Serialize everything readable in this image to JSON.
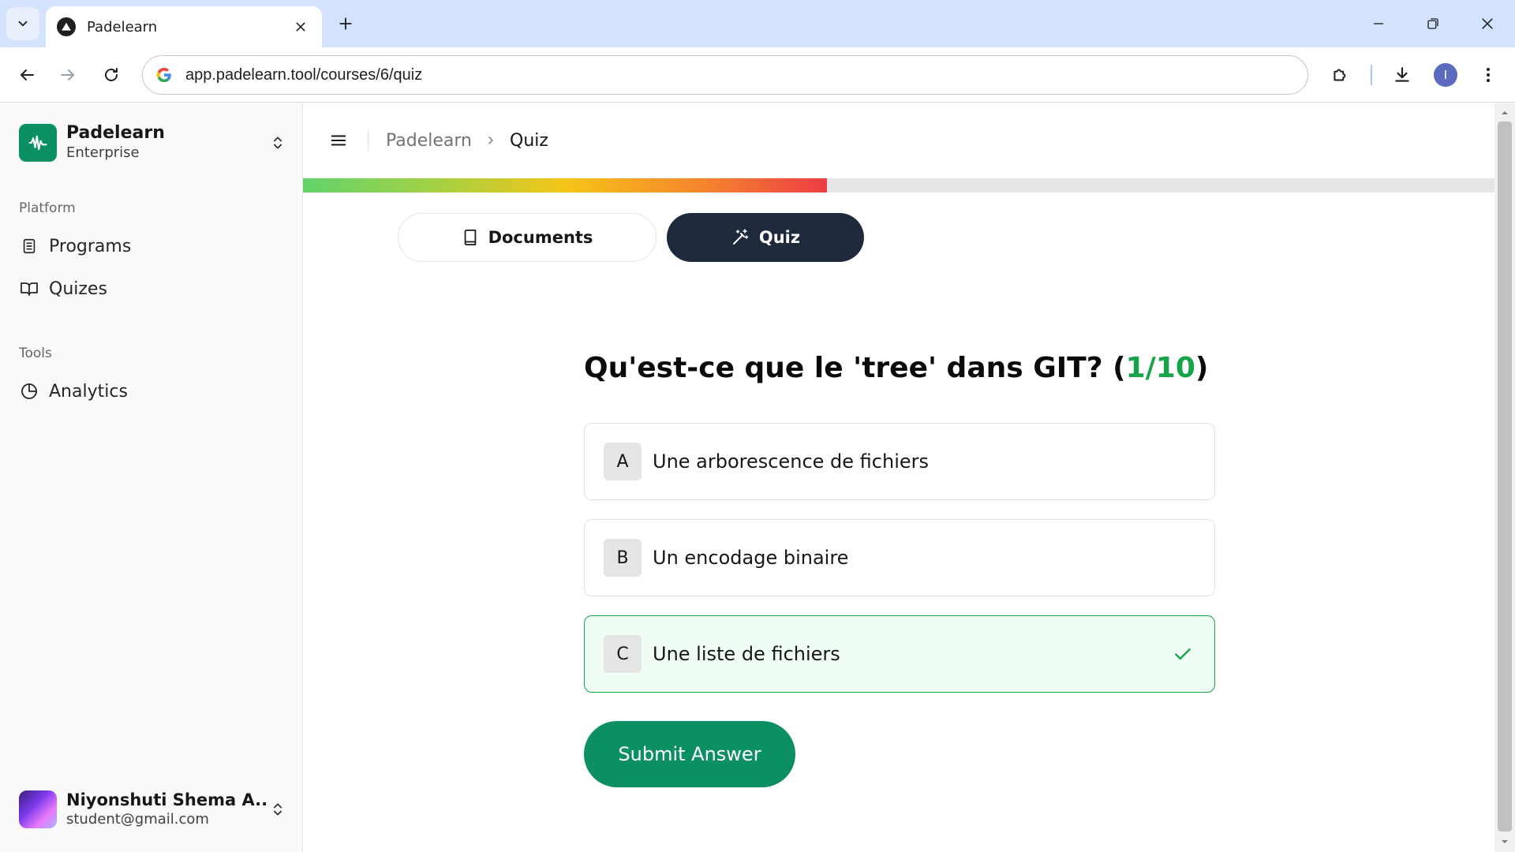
{
  "browser": {
    "tab_title": "Padelearn",
    "url": "app.padelearn.tool/courses/6/quiz",
    "profile_initial": "I"
  },
  "sidebar": {
    "brand_name": "Padelearn",
    "brand_plan": "Enterprise",
    "groups": [
      {
        "label": "Platform",
        "items": [
          {
            "label": "Programs",
            "icon": "document-icon"
          },
          {
            "label": "Quizes",
            "icon": "book-open-icon"
          }
        ]
      },
      {
        "label": "Tools",
        "items": [
          {
            "label": "Analytics",
            "icon": "pie-chart-icon"
          }
        ]
      }
    ],
    "user": {
      "name": "Niyonshuti Shema A...",
      "email": "student@gmail.com"
    }
  },
  "main": {
    "breadcrumb": {
      "root": "Padelearn",
      "current": "Quiz"
    },
    "progress_fraction": 0.44,
    "segments": {
      "documents": "Documents",
      "quiz": "Quiz"
    },
    "question": {
      "text": "Qu'est-ce que le 'tree' dans GIT? ",
      "paren_open": "(",
      "count": "1/10",
      "paren_close": ")"
    },
    "options": [
      {
        "letter": "A",
        "text": "Une arborescence de fichiers",
        "selected": false
      },
      {
        "letter": "B",
        "text": "Un encodage binaire",
        "selected": false
      },
      {
        "letter": "C",
        "text": "Une liste de fichiers",
        "selected": true
      }
    ],
    "submit_label": "Submit Answer"
  },
  "colors": {
    "brand_green": "#0c8f63",
    "success_green": "#16a34a",
    "dark_segment": "#1e293b",
    "tabstrip": "#d3e3fd"
  }
}
